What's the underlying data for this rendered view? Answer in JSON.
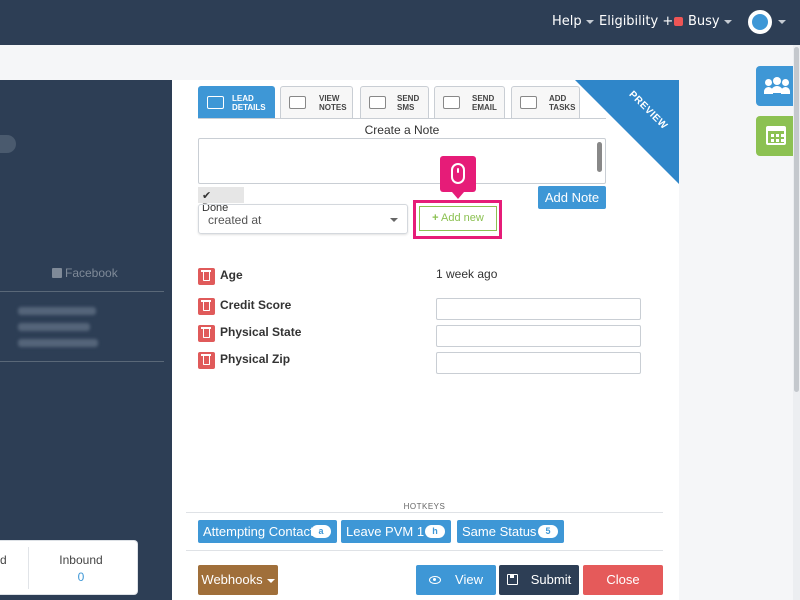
{
  "topbar": {
    "help": "Help",
    "eligibility": "Eligibility",
    "eligibility_suffix": "+",
    "status": "Busy"
  },
  "left_panel": {
    "facebook_label": "Facebook",
    "stats": {
      "fragment_label": "d",
      "inbound_label": "Inbound",
      "inbound_value": "0"
    }
  },
  "tabs": [
    {
      "line1": "LEAD",
      "line2": "DETAILS",
      "icon": "id-card-icon"
    },
    {
      "line1": "VIEW",
      "line2": "NOTES",
      "icon": "notes-icon"
    },
    {
      "line1": "SEND",
      "line2": "SMS",
      "icon": "chat-icon"
    },
    {
      "line1": "SEND",
      "line2": "EMAIL",
      "icon": "envelope-icon"
    },
    {
      "line1": "ADD",
      "line2": "TASKS",
      "icon": "calendar-icon"
    }
  ],
  "ribbon": "PREVIEW",
  "note": {
    "title": "Create a Note",
    "done_label": "Done",
    "add_note_button": "Add Note"
  },
  "select": {
    "value": "created at"
  },
  "add_new_button": "Add new",
  "fields": [
    {
      "label": "Age",
      "value": "1 week ago"
    },
    {
      "label": "Credit Score",
      "value": ""
    },
    {
      "label": "Physical State",
      "value": ""
    },
    {
      "label": "Physical Zip",
      "value": ""
    }
  ],
  "hotkeys": {
    "title": "HOTKEYS",
    "buttons": [
      {
        "label": "Attempting Contact",
        "key": "a"
      },
      {
        "label": "Leave PVM 1",
        "key": "h"
      },
      {
        "label": "Same Status",
        "key": "5"
      }
    ]
  },
  "actions": {
    "webhooks": "Webhooks",
    "view": "View",
    "submit": "Submit",
    "close": "Close"
  },
  "colors": {
    "navy": "#2d3e55",
    "blue": "#3e97d6",
    "green": "#8cc152",
    "red": "#e55a5a",
    "brown": "#a06f3a",
    "highlight": "#e61c78"
  }
}
